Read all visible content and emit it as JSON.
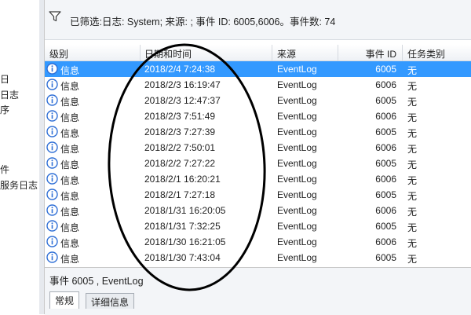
{
  "left_pane": {
    "items": [
      "日",
      "日志",
      "序",
      "件",
      "服务日志"
    ]
  },
  "filter": {
    "icon": "funnel-icon",
    "text": "已筛选:日志: System; 来源: ; 事件 ID: 6005,6006。事件数: 74"
  },
  "table": {
    "headers": {
      "level": "级别",
      "datetime": "日期和时间",
      "source": "来源",
      "event_id": "事件 ID",
      "task": "任务类别"
    },
    "rows": [
      {
        "level": "信息",
        "datetime": "2018/2/4 7:24:38",
        "source": "EventLog",
        "event_id": "6005",
        "task": "无",
        "selected": true
      },
      {
        "level": "信息",
        "datetime": "2018/2/3 16:19:47",
        "source": "EventLog",
        "event_id": "6006",
        "task": "无"
      },
      {
        "level": "信息",
        "datetime": "2018/2/3 12:47:37",
        "source": "EventLog",
        "event_id": "6005",
        "task": "无"
      },
      {
        "level": "信息",
        "datetime": "2018/2/3 7:51:49",
        "source": "EventLog",
        "event_id": "6006",
        "task": "无"
      },
      {
        "level": "信息",
        "datetime": "2018/2/3 7:27:39",
        "source": "EventLog",
        "event_id": "6005",
        "task": "无"
      },
      {
        "level": "信息",
        "datetime": "2018/2/2 7:50:01",
        "source": "EventLog",
        "event_id": "6006",
        "task": "无"
      },
      {
        "level": "信息",
        "datetime": "2018/2/2 7:27:22",
        "source": "EventLog",
        "event_id": "6005",
        "task": "无"
      },
      {
        "level": "信息",
        "datetime": "2018/2/1 16:20:21",
        "source": "EventLog",
        "event_id": "6006",
        "task": "无"
      },
      {
        "level": "信息",
        "datetime": "2018/2/1 7:27:18",
        "source": "EventLog",
        "event_id": "6005",
        "task": "无"
      },
      {
        "level": "信息",
        "datetime": "2018/1/31 16:20:05",
        "source": "EventLog",
        "event_id": "6006",
        "task": "无"
      },
      {
        "level": "信息",
        "datetime": "2018/1/31 7:32:25",
        "source": "EventLog",
        "event_id": "6005",
        "task": "无"
      },
      {
        "level": "信息",
        "datetime": "2018/1/30 16:21:05",
        "source": "EventLog",
        "event_id": "6006",
        "task": "无"
      },
      {
        "level": "信息",
        "datetime": "2018/1/30 7:43:04",
        "source": "EventLog",
        "event_id": "6005",
        "task": "无"
      }
    ]
  },
  "details": {
    "title": "事件 6005 , EventLog",
    "tabs": [
      {
        "label": "常规",
        "active": true
      },
      {
        "label": "详细信息",
        "active": false
      }
    ]
  },
  "annotation": {
    "shape": "ellipse",
    "color": "#000000"
  },
  "colors": {
    "selection": "#3399ff",
    "info_icon": "#2f6fd6",
    "background": "#ffffff"
  }
}
